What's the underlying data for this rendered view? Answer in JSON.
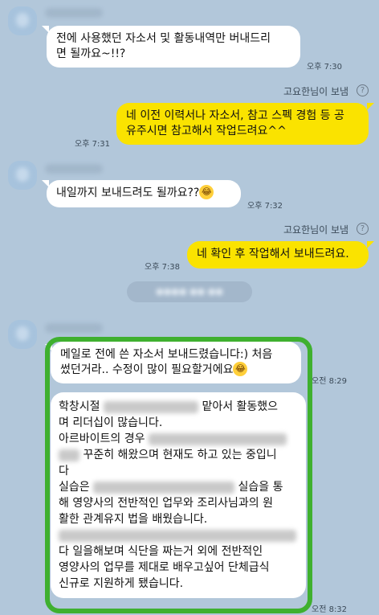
{
  "messages": {
    "m1": {
      "line1": "전에 사용했던 자소서 및 활동내역만 버내드리",
      "line2": "면 될까요~!!?",
      "time": "오후 7:30"
    },
    "sent_by_1": "고요한님이 보냄",
    "m2": {
      "line1": "네 이전 이력서나 자소서, 참고 스펙 경험 등 공",
      "line2": "유주시면 참고해서 작업드려요^^",
      "time": "오후 7:31"
    },
    "m3": {
      "text": "내일까지 보내드려도 될까요??",
      "time": "오후 7:32"
    },
    "sent_by_2": "고요한님이 보냄",
    "m4": {
      "text": "네 확인 후 작업해서 보내드려요.",
      "time": "오후 7:38"
    },
    "m5": {
      "line1": "메일로 전에 쓴 자소서 보내드렸습니다:) 처음",
      "line2": "썼던거라.. 수정이 많이 필요할거에요",
      "time": "오전 8:29"
    },
    "m6": {
      "l1a": "학창시절",
      "l1b": "맡아서 활동했으",
      "l2": "며 리더십이 많습니다.",
      "l3": "아르바이트의 경우",
      "l4": " 꾸준히 해왔으며 현재도 하고 있는 중입니",
      "l5": "다",
      "l6a": "실습은",
      "l6b": "실습을 통",
      "l7": "해 영양사의 전반적인 업무와 조리사님과의 원",
      "l8": "활한 관계유지 법을 배웠습니다.",
      "l10": " 다 일을해보며 식단을 짜는거 외에 전반적인",
      "l11": "영양사의 업무를 제대로 배우고싶어 단체급식",
      "l12": "신규로 지원하게 됐습니다.",
      "time": "오전 8:32"
    }
  },
  "icons": {
    "help": "question-circle-icon",
    "emoji": "laughing-tears-emoji-icon"
  },
  "colors": {
    "background": "#b2c7da",
    "my_bubble": "#fae300",
    "their_bubble": "#ffffff",
    "highlight": "#3fb02f"
  }
}
